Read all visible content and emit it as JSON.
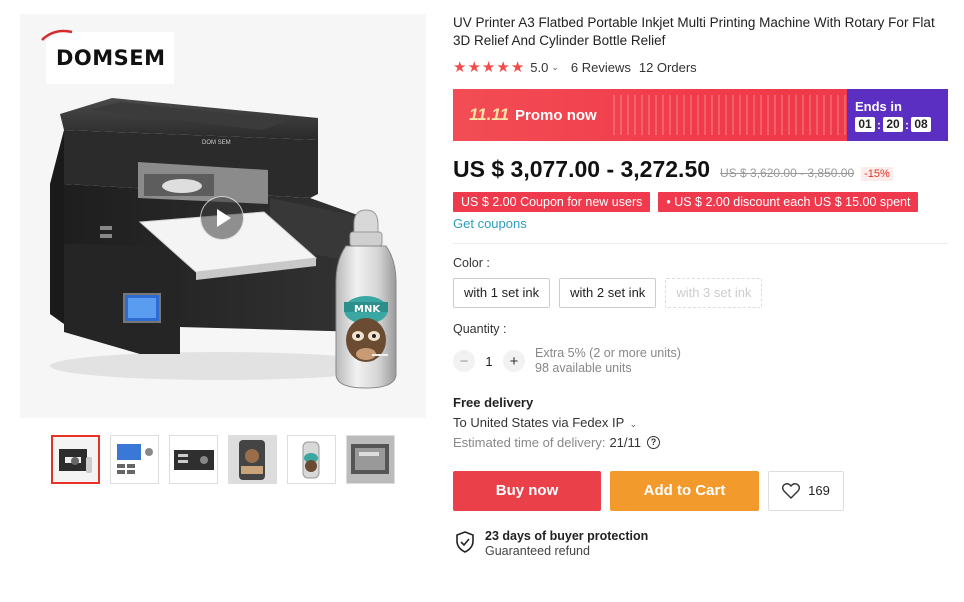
{
  "brand": {
    "name": "DOMSEM"
  },
  "product": {
    "title": "UV Printer A3 Flatbed Portable Inkjet Multi Printing Machine With Rotary For Flat 3D Relief And Cylinder Bottle Relief",
    "printer_label": "DOM SEM",
    "bottle_label": "MNK",
    "rating": "5.0",
    "reviews": "6 Reviews",
    "orders": "12 Orders",
    "star_count": 5
  },
  "gallery": {
    "thumbnails": [
      "printer-front",
      "control-panel",
      "printer-side",
      "printed-case",
      "printed-bottle",
      "print-sample"
    ],
    "active_index": 0
  },
  "promo": {
    "tag": "11.11",
    "text": "Promo now",
    "ends_label": "Ends in",
    "hours": "01",
    "minutes": "20",
    "seconds": "08",
    "separator": ":"
  },
  "price": {
    "current": "US $ 3,077.00 - 3,272.50",
    "original": "US $ 3,620.00 - 3,850.00",
    "discount": "-15%"
  },
  "coupons": {
    "items": [
      "US $ 2.00 Coupon for new users",
      "• US $ 2.00 discount each US $ 15.00 spent"
    ],
    "get_coupons": "Get coupons"
  },
  "color": {
    "label": "Color :",
    "options": [
      "with 1 set ink",
      "with 2 set ink",
      "with 3 set ink"
    ]
  },
  "quantity": {
    "label": "Quantity :",
    "minus": "−",
    "plus": "+",
    "value": "1",
    "extra": "Extra 5% (2 or more units)",
    "available": "98 available units"
  },
  "delivery": {
    "free": "Free delivery",
    "ship_to": "To United States via Fedex IP",
    "estimated_label": "Estimated time of delivery:",
    "estimated_date": "21/11",
    "help": "?"
  },
  "actions": {
    "buy_now": "Buy now",
    "add_to_cart": "Add to Cart",
    "wishlist_count": "169"
  },
  "protection": {
    "title": "23 days of buyer protection",
    "subtitle": "Guaranteed refund"
  },
  "colors": {
    "star": "#f34a4a",
    "promo_red": "#f13b4b",
    "promo_purple": "#5b2fc2",
    "coupon": "#ef3a4e",
    "link": "#2e9cc0",
    "buy": "#e9404a",
    "cart": "#f39a2c"
  }
}
